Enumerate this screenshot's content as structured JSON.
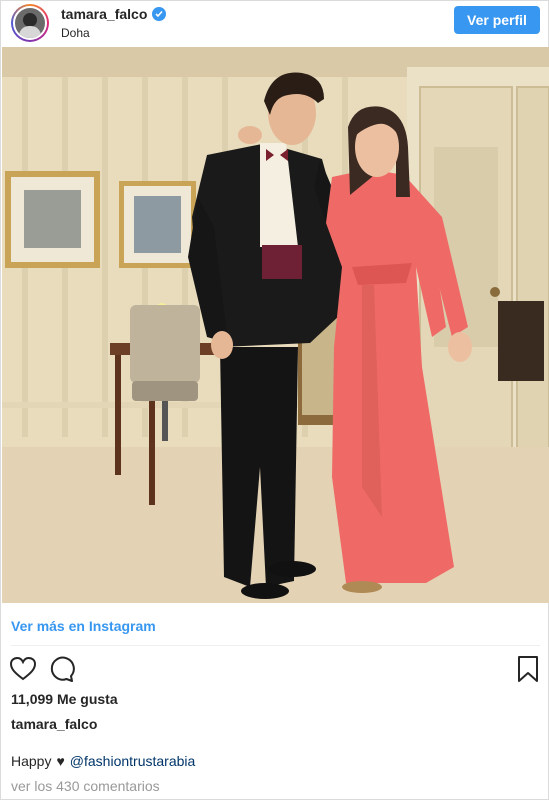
{
  "header": {
    "username": "tamara_falco",
    "location": "Doha",
    "follow_label": "Ver perfil",
    "verified_icon": "verified-badge-icon"
  },
  "post": {
    "photo_description_icon": "post-photo"
  },
  "footer": {
    "view_more": "Ver más en Instagram",
    "likes": "11,099 Me gusta",
    "owner": "tamara_falco",
    "caption_text": "Happy",
    "caption_heart": "♥",
    "caption_mention": "@fashiontrustarabia",
    "comments_link": "ver los 430 comentarios",
    "icons": [
      "heart-icon",
      "comment-icon",
      "bookmark-icon"
    ]
  },
  "colors": {
    "accent": "#3897f0",
    "text": "#262626",
    "muted": "#999999",
    "mention": "#003569"
  }
}
